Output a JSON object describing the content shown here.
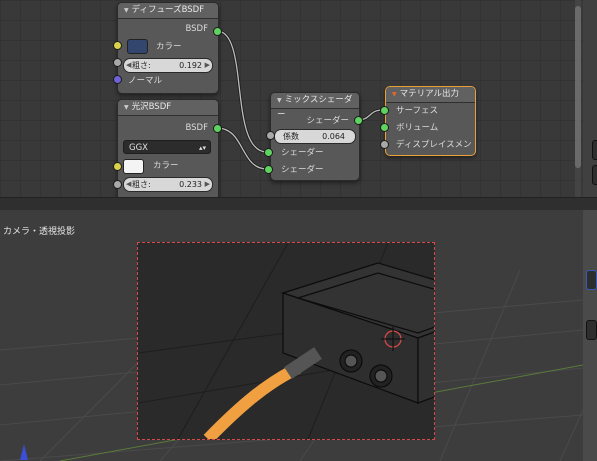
{
  "nodes": {
    "diffuse": {
      "title": "ディフューズBSDF",
      "out_label": "BSDF",
      "color_label": "カラー",
      "color_value": "#33476e",
      "roughness_label": "粗さ:",
      "roughness_value": "0.192",
      "normal_label": "ノーマル"
    },
    "glossy": {
      "title": "光沢BSDF",
      "out_label": "BSDF",
      "distribution": "GGX",
      "color_label": "カラー",
      "color_value": "#f4f4f4",
      "roughness_label": "粗さ:",
      "roughness_value": "0.233"
    },
    "mix": {
      "title": "ミックスシェーダー",
      "out_label": "シェーダー",
      "factor_label": "係数",
      "factor_value": "0.064",
      "in1_label": "シェーダー",
      "in2_label": "シェーダー"
    },
    "output": {
      "title": "マテリアル出力",
      "surface_label": "サーフェス",
      "volume_label": "ボリューム",
      "displacement_label": "ディスプレイスメン"
    }
  },
  "viewport": {
    "label": "カメラ・透視投影"
  },
  "colors": {
    "socket_shader": "#5fd35f",
    "socket_value": "#a8a8a8",
    "socket_color": "#d9d24a",
    "socket_vector": "#6e63d6",
    "active_node_border": "#e8a136",
    "cable": "#f0a040",
    "camera_frame": "#d94848"
  }
}
